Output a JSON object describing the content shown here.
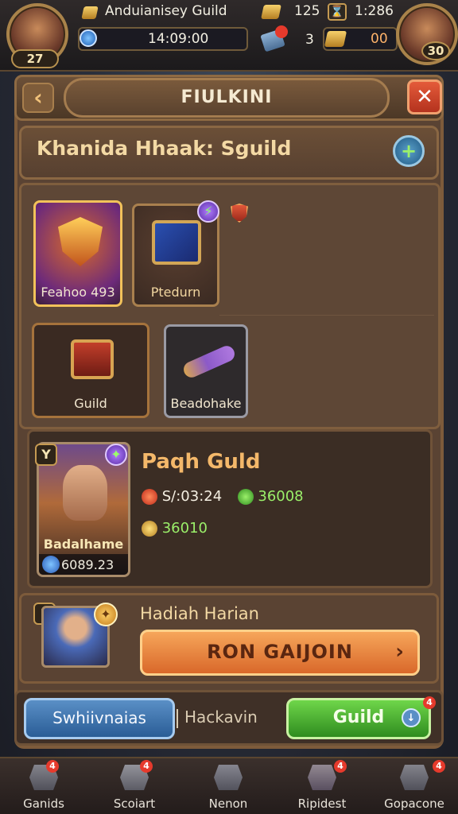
{
  "topbar": {
    "left_level": "27",
    "title": "Anduianisey Guild",
    "timer": "14:09:00",
    "gold": "125",
    "clock": "1:286",
    "gems": "3",
    "coins": "00",
    "right_level": "30"
  },
  "header": {
    "title": "FIULKINI"
  },
  "guild": {
    "name": "Khanida Hhaak: Sguild"
  },
  "tiles": [
    {
      "label": "Feahoo 493"
    },
    {
      "label": "Ptedurn"
    },
    {
      "label": "Guild"
    },
    {
      "label": "Beadohake"
    }
  ],
  "hero": {
    "rank_badge": "Y",
    "title": "Paqh Guld",
    "stat1": "S/:03:24",
    "stat2": "36008",
    "stat3": "36010",
    "name": "Badalhame",
    "power": "6089.23"
  },
  "member": {
    "rank": "1",
    "name": "Hadiah Harian",
    "join_label": "RON GAIJOIN"
  },
  "actions": {
    "left_label": "Swhiivnaias",
    "middle_label": "Hackavin",
    "right_label": "Guild",
    "right_badge": "4"
  },
  "nav": [
    {
      "label": "Ganids",
      "badge": "4"
    },
    {
      "label": "Scoiart",
      "badge": "4"
    },
    {
      "label": "Nenon",
      "badge": ""
    },
    {
      "label": "Ripidest",
      "badge": "4"
    },
    {
      "label": "Gopacone",
      "badge": "4"
    }
  ]
}
